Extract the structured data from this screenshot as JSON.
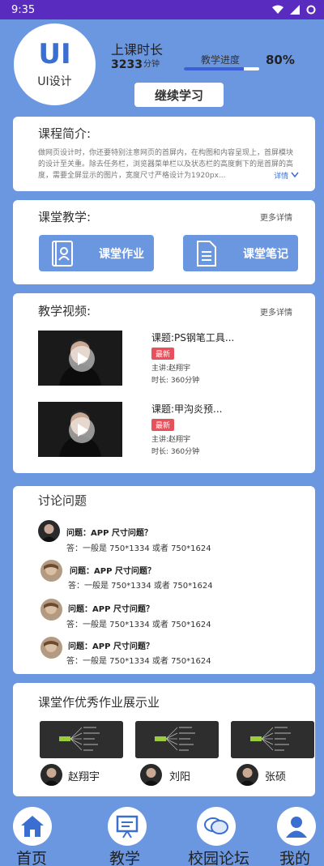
{
  "status_bar": {
    "time": "9:35"
  },
  "header": {
    "logo_text": "UI",
    "logo_subtitle": "UI设计",
    "study_time_label": "上课时长",
    "study_minutes": "3233",
    "study_unit": "分钟",
    "progress_label": "教学进度",
    "progress_value": "80%",
    "progress_fraction": 0.8,
    "continue_button": "继续学习"
  },
  "intro": {
    "title": "课程简介:",
    "text": "做网页设计时，你还要特别注意网页的首屏内，在构图和内容呈现上，首屏模块的设计至关重。除去任务栏，浏览器菜单栏以及状态栏的高度剩下的是首屏的高度，需要全屏显示的图片，宽度尺寸严格设计为1920px...",
    "detail_link": "详情"
  },
  "classroom": {
    "title": "课堂教学:",
    "more": "更多详情",
    "buttons": [
      {
        "label": "课堂作业",
        "icon": "contacts-book-icon"
      },
      {
        "label": "课堂笔记",
        "icon": "document-icon"
      }
    ]
  },
  "videos": {
    "title": "教学视频:",
    "more": "更多详情",
    "items": [
      {
        "title": "课题:PS钢笔工具...",
        "badge": "最新",
        "lecturer": "主讲:赵翔宇",
        "duration": "时长: 360分钟"
      },
      {
        "title": "课题:甲沟炎预...",
        "badge": "最新",
        "lecturer": "主讲:赵翔宇",
        "duration": "时长: 360分钟"
      }
    ]
  },
  "discussion": {
    "title": "讨论问题",
    "items": [
      {
        "question": "问题：APP 尺寸问题？",
        "answer": "答：一般是 750*1334 或者 750*1624"
      },
      {
        "question": "问题：APP 尺寸问题？",
        "answer": "答：一般是 750*1334 或者 750*1624"
      },
      {
        "question": "问题：APP 尺寸问题？",
        "answer": "答：一般是 750*1334 或者 750*1624"
      },
      {
        "question": "问题：APP 尺寸问题？",
        "answer": "答：一般是 750*1334 或者 750*1624"
      }
    ]
  },
  "showcase": {
    "title": "课堂作优秀作业展示业",
    "items": [
      {
        "name": "赵翔宇"
      },
      {
        "name": "刘阳"
      },
      {
        "name": "张硕"
      }
    ]
  },
  "tabbar": {
    "items": [
      {
        "label": "首页",
        "icon": "home-icon"
      },
      {
        "label": "教学",
        "icon": "presentation-icon"
      },
      {
        "label": "校园论坛",
        "icon": "chat-bubbles-icon"
      },
      {
        "label": "我的",
        "icon": "user-icon"
      }
    ]
  },
  "colors": {
    "background": "#6b97e0",
    "status_bar": "#5a2bbf",
    "accent": "#3a6fd1",
    "badge": "#e8505b"
  }
}
